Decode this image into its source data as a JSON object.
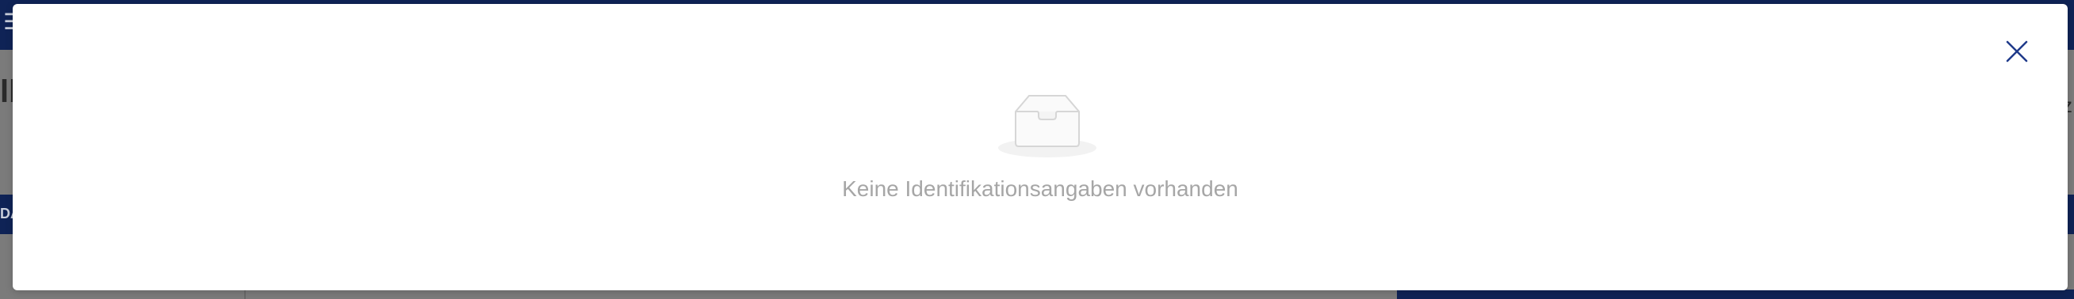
{
  "background": {
    "left_fragment": "lb",
    "band_fragment": "DA",
    "menu_icon": "hamburger-icon"
  },
  "modal": {
    "close_icon": "close-icon",
    "empty_icon": "empty-inbox-icon",
    "empty_message": "Keine Identifikationsangaben vorhanden"
  },
  "colors": {
    "topbar": "#0f2356",
    "overlay": "#7b7b7b",
    "modal_bg": "#ffffff",
    "close_icon": "#1f3a8a",
    "empty_text": "#a6a6a6"
  }
}
